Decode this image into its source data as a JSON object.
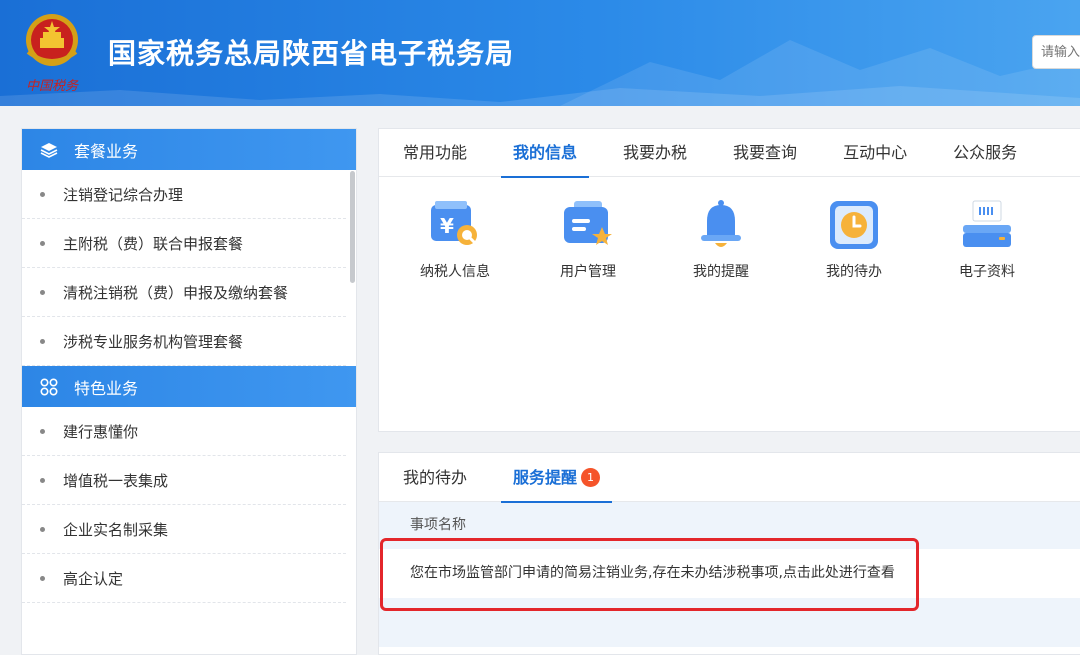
{
  "header": {
    "site_title": "国家税务总局陕西省电子税务局",
    "emblem_text": "中国税务",
    "search_placeholder": "请输入"
  },
  "sidebar": {
    "section1": {
      "title": "套餐业务",
      "icon": "layers-icon"
    },
    "section1_items": [
      "注销登记综合办理",
      "主附税（费）联合申报套餐",
      "清税注销税（费）申报及缴纳套餐",
      "涉税专业服务机构管理套餐"
    ],
    "section2": {
      "title": "特色业务",
      "icon": "grid-icon"
    },
    "section2_items": [
      "建行惠懂你",
      "增值税一表集成",
      "企业实名制采集",
      "高企认定"
    ]
  },
  "main": {
    "tabs": [
      "常用功能",
      "我的信息",
      "我要办税",
      "我要查询",
      "互动中心",
      "公众服务"
    ],
    "active_tab": "我的信息",
    "functions": [
      {
        "label": "纳税人信息",
        "icon": "taxpayer-info-icon"
      },
      {
        "label": "用户管理",
        "icon": "user-management-icon"
      },
      {
        "label": "我的提醒",
        "icon": "bell-icon"
      },
      {
        "label": "我的待办",
        "icon": "clock-icon"
      },
      {
        "label": "电子资料",
        "icon": "scanner-icon"
      }
    ]
  },
  "service": {
    "tabs": [
      "我的待办",
      "服务提醒"
    ],
    "active_tab": "服务提醒",
    "badge_count": "1",
    "column_header": "事项名称",
    "rows": [
      "您在市场监管部门申请的简易注销业务,存在未办结涉税事项,点击此处进行查看"
    ]
  },
  "colors": {
    "primary": "#1a6fd6",
    "badge": "#f5542a",
    "highlight": "#e3262b"
  }
}
